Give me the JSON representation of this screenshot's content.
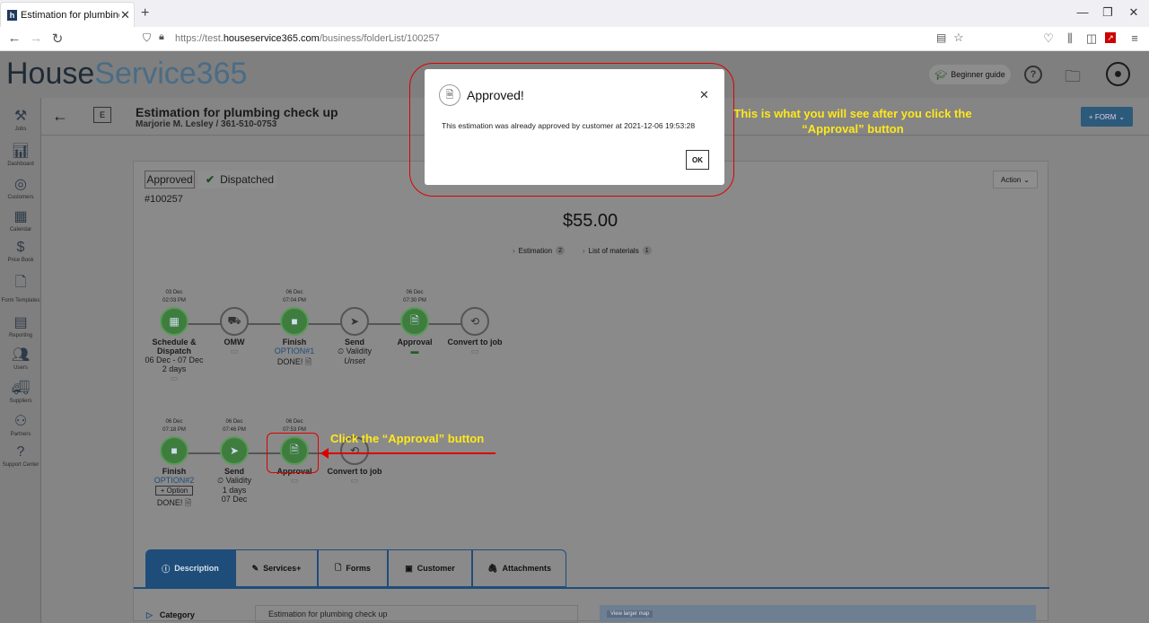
{
  "browser": {
    "tab_title": "Estimation for plumbing check",
    "url_prefix": "https://test.",
    "url_domain": "houseservice365.com",
    "url_path": "/business/folderList/100257"
  },
  "app": {
    "logo_house": "House",
    "logo_service": "Service365",
    "beginner_guide": "Beginner guide",
    "form_button": "+ FORM",
    "sidebar": [
      {
        "label": "Jobs",
        "icon": "jobs-icon"
      },
      {
        "label": "Dashboard",
        "icon": "dashboard-icon"
      },
      {
        "label": "Customers",
        "icon": "customers-icon"
      },
      {
        "label": "Calendar",
        "icon": "calendar-icon"
      },
      {
        "label": "Price Book",
        "icon": "price-book-icon"
      },
      {
        "label": "Form Templates",
        "icon": "form-templates-icon"
      },
      {
        "label": "Reporting",
        "icon": "reporting-icon"
      },
      {
        "label": "Users",
        "icon": "users-icon"
      },
      {
        "label": "Suppliers",
        "icon": "suppliers-icon"
      },
      {
        "label": "Partners",
        "icon": "partners-icon"
      },
      {
        "label": "Support Center",
        "icon": "support-center-icon"
      }
    ]
  },
  "page": {
    "badge": "E",
    "title": "Estimation for plumbing check up",
    "subtitle": "Marjorie M. Lesley / 361-510-0753",
    "status_approved": "Approved",
    "status_dispatched": "Dispatched",
    "number": "#100257",
    "action": "Action",
    "total": "$55.00",
    "link_estimation": "Estimation",
    "link_estimation_count": "2",
    "link_materials": "List of materials",
    "link_materials_count": "1"
  },
  "timeline1": [
    {
      "date": "03 Dec",
      "time": "02:03 PM",
      "name": "Schedule & Dispatch",
      "sub1": "06 Dec - 07 Dec",
      "sub2": "2 days",
      "done": true
    },
    {
      "date": "",
      "time": "",
      "name": "OMW",
      "sub1": "",
      "sub2": "",
      "done": false
    },
    {
      "date": "06 Dec",
      "time": "07:04 PM",
      "name": "Finish",
      "sub1": "OPTION#1",
      "sub2": "DONE!",
      "done": true
    },
    {
      "date": "",
      "time": "",
      "name": "Send",
      "sub1": "Validity",
      "sub2": "Unset",
      "done": false
    },
    {
      "date": "06 Dec",
      "time": "07:30 PM",
      "name": "Approval",
      "sub1": "",
      "sub2": "",
      "done": true
    },
    {
      "date": "",
      "time": "",
      "name": "Convert to job",
      "sub1": "",
      "sub2": "",
      "done": false
    }
  ],
  "timeline2": [
    {
      "date": "06 Dec",
      "time": "07:18 PM",
      "name": "Finish",
      "sub1": "OPTION#2",
      "sub2": "+ Option",
      "sub3": "DONE!",
      "done": true
    },
    {
      "date": "06 Dec",
      "time": "07:46 PM",
      "name": "Send",
      "sub1": "Validity",
      "sub2": "1 days",
      "sub3": "07 Dec",
      "done": true
    },
    {
      "date": "06 Dec",
      "time": "07:53 PM",
      "name": "Approval",
      "sub1": "",
      "sub2": "",
      "sub3": "",
      "done": true
    },
    {
      "date": "",
      "time": "",
      "name": "Convert to job",
      "sub1": "",
      "sub2": "",
      "sub3": "",
      "done": false
    }
  ],
  "tabs": [
    "Description",
    "Services+",
    "Forms",
    "Customer",
    "Attachments"
  ],
  "description": {
    "category_label": "Category",
    "category_value": "Estimation for plumbing check up",
    "map_tag": "View larger map"
  },
  "modal": {
    "title": "Approved!",
    "message": "This estimation was already approved by customer at 2021-12-06 19:53:28",
    "ok": "OK"
  },
  "annotations": {
    "top_line1": "This is what you will see after you click the",
    "top_line2": "“Approval” button",
    "click": "Click the “Approval” button"
  }
}
